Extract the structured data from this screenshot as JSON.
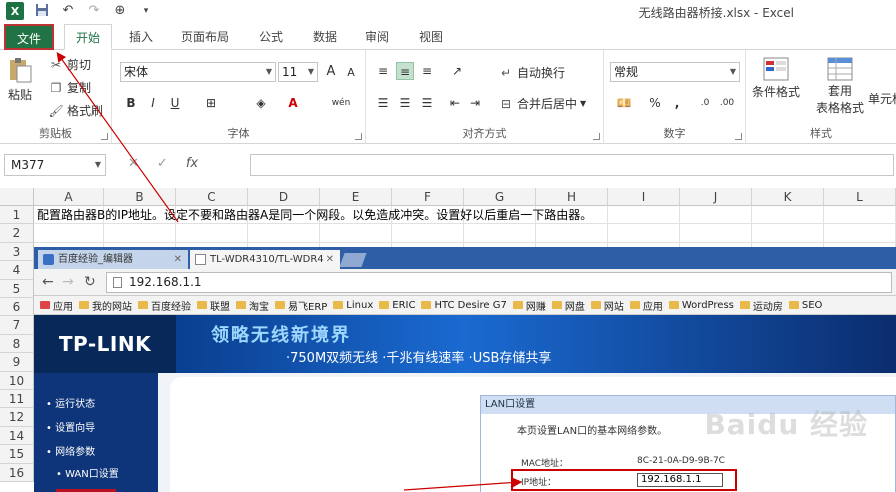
{
  "window": {
    "title": "无线路由器桥接.xlsx - Excel",
    "app_icon_text": "X"
  },
  "tabs": [
    {
      "label": "文件"
    },
    {
      "label": "开始"
    },
    {
      "label": "插入"
    },
    {
      "label": "页面布局"
    },
    {
      "label": "公式"
    },
    {
      "label": "数据"
    },
    {
      "label": "审阅"
    },
    {
      "label": "视图"
    }
  ],
  "ribbon": {
    "clipboard": {
      "paste": "粘贴",
      "cut": "剪切",
      "copy": "复制",
      "format_painter": "格式刷",
      "label": "剪贴板"
    },
    "font": {
      "name": "宋体",
      "size": "11",
      "label": "字体",
      "grow": "A",
      "shrink": "A",
      "bold": "B",
      "italic": "I",
      "underline": "U",
      "phonetic": "wén"
    },
    "alignment": {
      "wrap": "自动换行",
      "merge": "合并后居中",
      "label": "对齐方式"
    },
    "number": {
      "format": "常规",
      "percent": "%",
      "comma": ",",
      "label": "数字"
    },
    "styles": {
      "conditional": "条件格式",
      "table_line1": "套用",
      "table_line2": "表格格式",
      "cell": "单元格",
      "label": "样式"
    }
  },
  "formula_bar": {
    "name_box": "M377",
    "cancel": "✕",
    "enter": "✓",
    "fx": "fx",
    "content": ""
  },
  "grid": {
    "columns": [
      "A",
      "B",
      "C",
      "D",
      "E",
      "F",
      "G",
      "H",
      "I",
      "J",
      "K",
      "L"
    ],
    "rows": [
      "1",
      "2",
      "3",
      "4",
      "5",
      "6",
      "7",
      "8",
      "9",
      "10",
      "11",
      "12",
      "14",
      "15",
      "16"
    ],
    "a1": "配置路由器B的IP地址。设定不要和路由器A是同一个网段。以免造成冲突。设置好以后重启一下路由器。"
  },
  "browser": {
    "tab1": "百度经验_编辑器",
    "tab2": "TL-WDR4310/TL-WDR4",
    "url": "192.168.1.1",
    "bookmarks": [
      "应用",
      "我的网站",
      "百度经验",
      "联盟",
      "淘宝",
      "易飞ERP",
      "Linux",
      "ERIC",
      "HTC Desire G7",
      "网赚",
      "网盘",
      "网站",
      "应用",
      "WordPress",
      "运动房",
      "SEO"
    ],
    "logo": "TP-LINK",
    "slogan": "领略无线新境界",
    "tagline": "·750M双频无线 ·千兆有线速率 ·USB存储共享",
    "sidebar": [
      "• 运行状态",
      "• 设置向导",
      "• 网络参数",
      "• WAN口设置"
    ],
    "panel_title": "LAN口设置",
    "panel_text": "本页设置LAN口的基本网络参数。",
    "mac_label": "MAC地址：",
    "mac_value": "8C-21-0A-D9-9B-7C",
    "ip_label": "IP地址：",
    "ip_value": "192.168.1.1",
    "watermark": "Baidu 经验"
  }
}
